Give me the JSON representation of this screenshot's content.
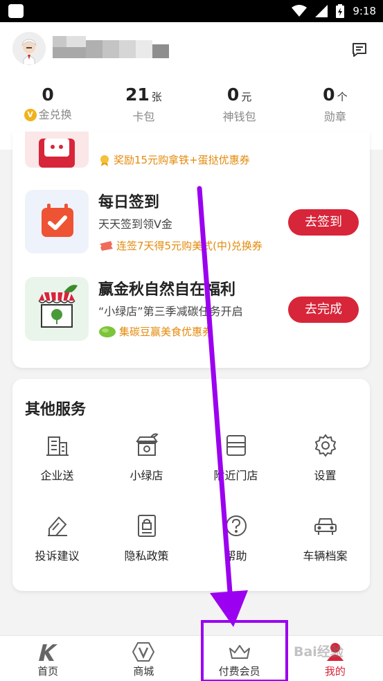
{
  "status_bar": {
    "time": "9:18"
  },
  "header": {
    "message_icon": "message-icon",
    "stats": [
      {
        "value": "0",
        "unit": "",
        "label": "金兑换",
        "coin": "V"
      },
      {
        "value": "21",
        "unit": "张",
        "label": "卡包"
      },
      {
        "value": "0",
        "unit": "元",
        "label": "神钱包"
      },
      {
        "value": "0",
        "unit": "个",
        "label": "勋章"
      }
    ]
  },
  "tasks": {
    "partial_reward": "奖励15元购拿铁+蛋挞优惠券",
    "items": [
      {
        "title": "每日签到",
        "desc": "天天签到领V金",
        "reward": "连签7天得5元购美式(中)兑换券",
        "button": "去签到"
      },
      {
        "title": "赢金秋自然自在福利",
        "desc": "“小绿店”第三季减碳任务开启",
        "reward": "集碳豆赢美食优惠券",
        "button": "去完成"
      }
    ]
  },
  "services": {
    "title": "其他服务",
    "items": [
      {
        "label": "企业送",
        "icon": "building-icon"
      },
      {
        "label": "小绿店",
        "icon": "green-store-icon"
      },
      {
        "label": "附近门店",
        "icon": "store-icon"
      },
      {
        "label": "设置",
        "icon": "gear-icon"
      },
      {
        "label": "投诉建议",
        "icon": "feedback-icon"
      },
      {
        "label": "隐私政策",
        "icon": "privacy-icon"
      },
      {
        "label": "帮助",
        "icon": "help-icon"
      },
      {
        "label": "车辆档案",
        "icon": "car-icon"
      }
    ]
  },
  "bottom_nav": {
    "items": [
      {
        "label": "首页",
        "icon": "home-k-icon"
      },
      {
        "label": "商城",
        "icon": "mall-v-icon"
      },
      {
        "label": "付费会员",
        "icon": "crown-icon"
      },
      {
        "label": "我的",
        "icon": "profile-icon"
      }
    ],
    "active": "我的"
  },
  "colors": {
    "accent": "#d7253a",
    "reward": "#e38a0b",
    "annotation": "#9b00f0"
  },
  "watermark": "Bai经验"
}
